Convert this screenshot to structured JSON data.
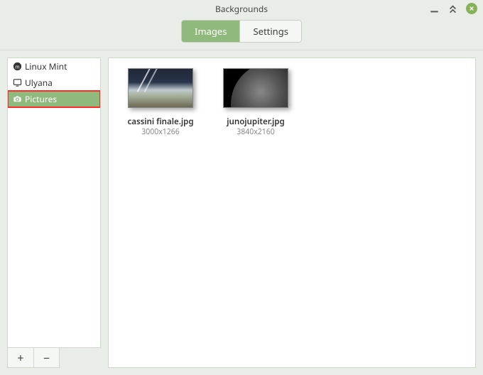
{
  "window": {
    "title": "Backgrounds"
  },
  "tabs": {
    "images": "Images",
    "settings": "Settings"
  },
  "sidebar": {
    "items": [
      {
        "label": "Linux Mint"
      },
      {
        "label": "Ulyana"
      },
      {
        "label": "Pictures"
      }
    ]
  },
  "buttons": {
    "add": "+",
    "remove": "−"
  },
  "images": [
    {
      "name": "cassini finale.jpg",
      "dimensions": "3000x1266"
    },
    {
      "name": "junojupiter.jpg",
      "dimensions": "3840x2160"
    }
  ]
}
